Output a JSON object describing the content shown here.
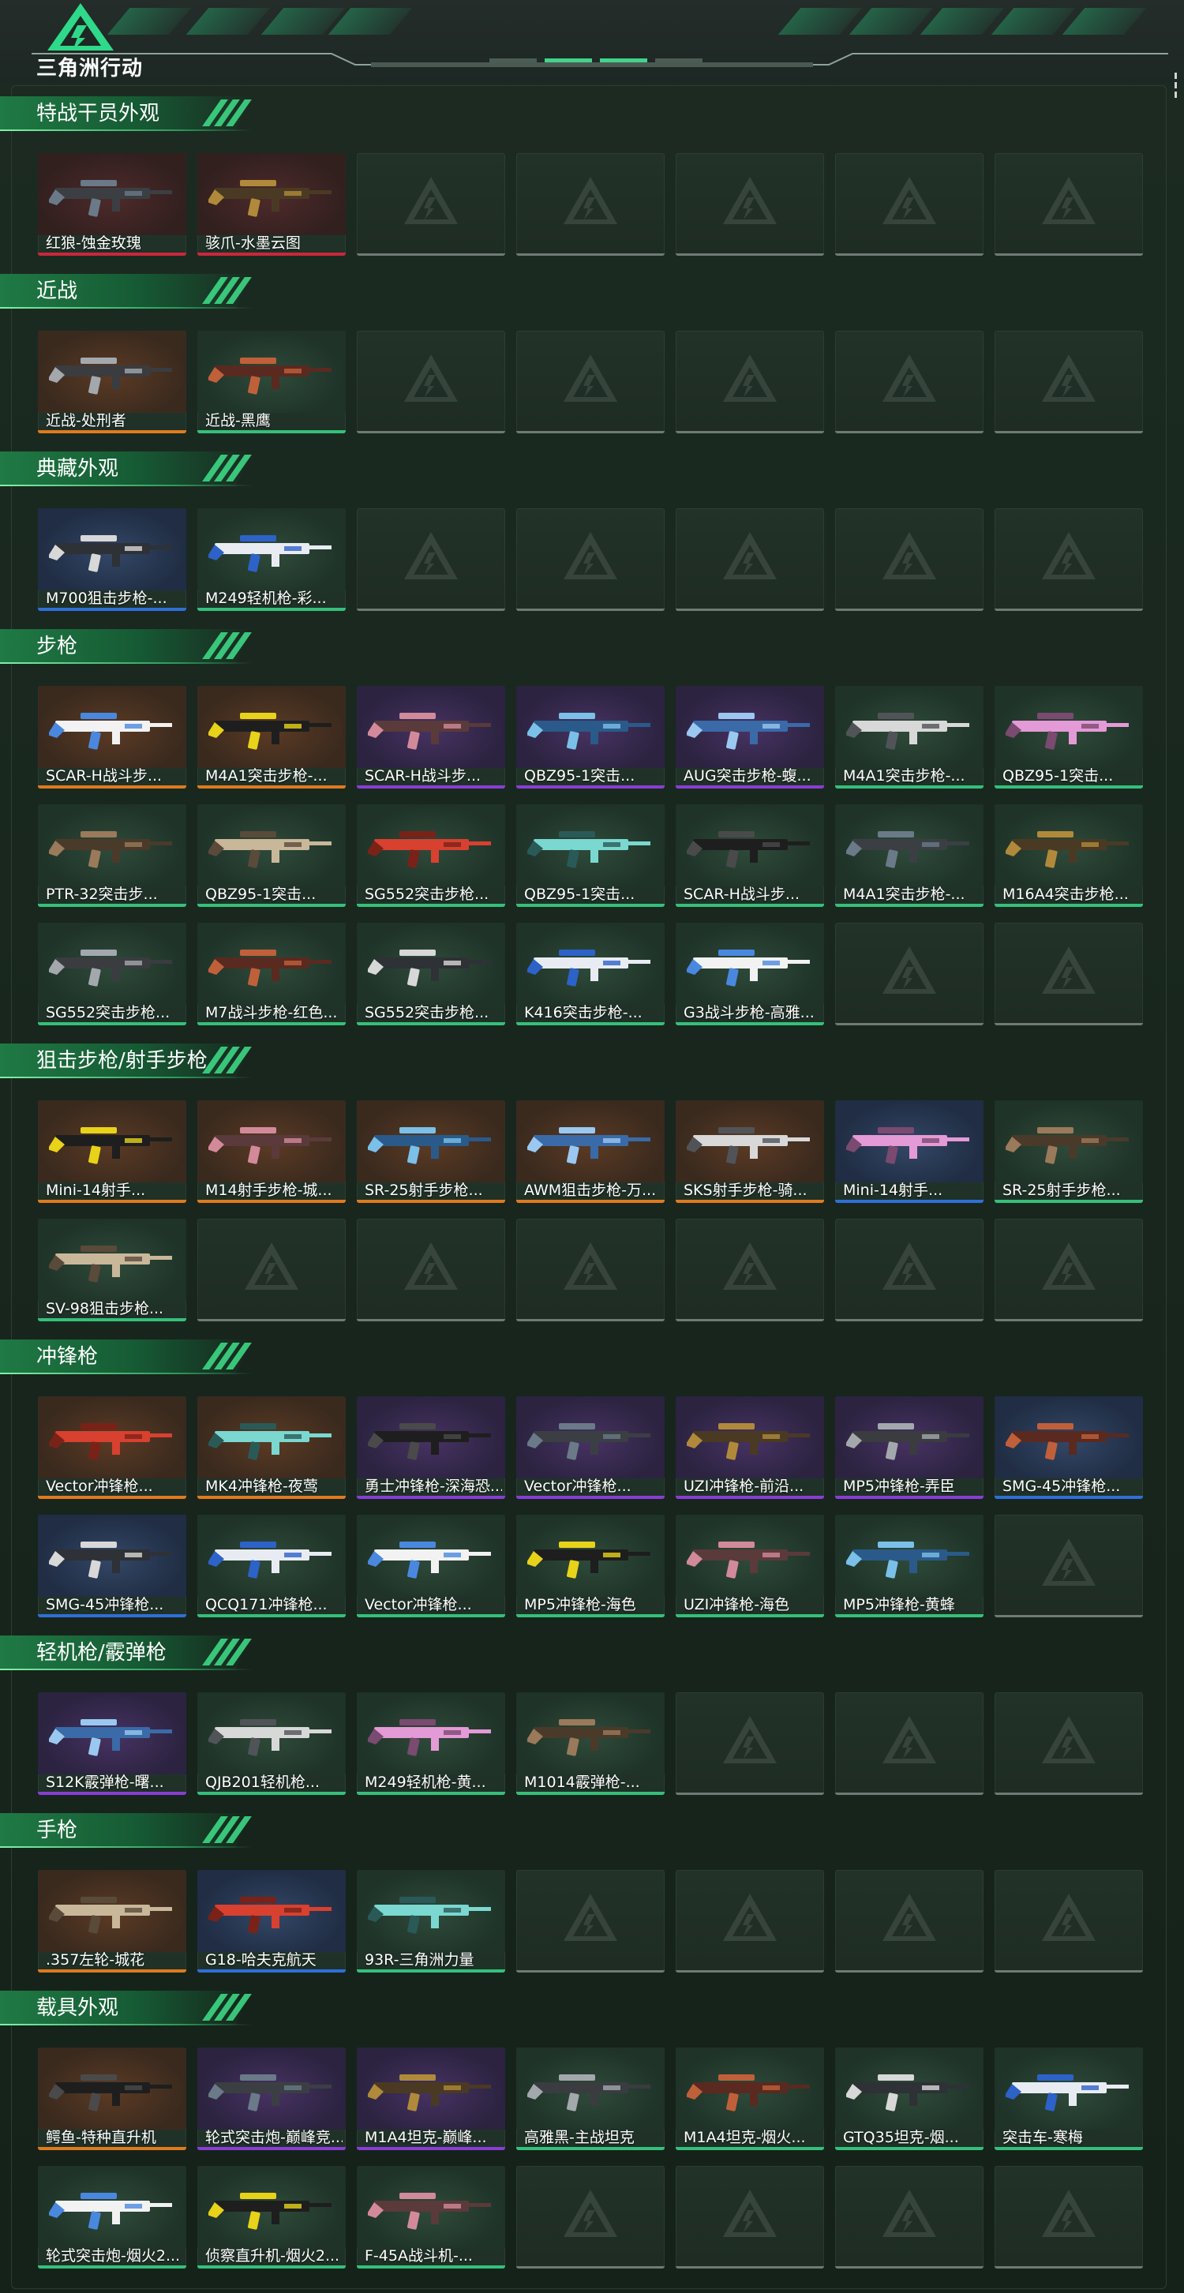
{
  "app": {
    "logo_text": "三角洲行动"
  },
  "colors": {
    "accent": "#35c07a",
    "rarity_orange": "#e07a1e",
    "rarity_red": "#c9283a",
    "rarity_purple": "#8a3dd6",
    "rarity_blue": "#2f6fd9",
    "rarity_green": "#35c07a",
    "empty_slot": "#6f7a75"
  },
  "sections": [
    {
      "title": "特战干员外观",
      "items": [
        {
          "label": "红狼-蚀金玫瑰",
          "rarity": "red"
        },
        {
          "label": "骇爪-水墨云图",
          "rarity": "red"
        }
      ]
    },
    {
      "title": "近战",
      "items": [
        {
          "label": "近战-处刑者",
          "rarity": "orange"
        },
        {
          "label": "近战-黑鹰",
          "rarity": "green"
        }
      ]
    },
    {
      "title": "典藏外观",
      "items": [
        {
          "label": "M700狙击步枪-...",
          "rarity": "blue"
        },
        {
          "label": "M249轻机枪-彩...",
          "rarity": "green"
        }
      ]
    },
    {
      "title": "步枪",
      "items": [
        {
          "label": "SCAR-H战斗步...",
          "rarity": "orange"
        },
        {
          "label": "M4A1突击步枪-...",
          "rarity": "orange"
        },
        {
          "label": "SCAR-H战斗步...",
          "rarity": "purple"
        },
        {
          "label": "QBZ95-1突击...",
          "rarity": "purple"
        },
        {
          "label": "AUG突击步枪-蝮...",
          "rarity": "purple"
        },
        {
          "label": "M4A1突击步枪-...",
          "rarity": "green"
        },
        {
          "label": "QBZ95-1突击...",
          "rarity": "green"
        },
        {
          "label": "PTR-32突击步...",
          "rarity": "green"
        },
        {
          "label": "QBZ95-1突击...",
          "rarity": "green"
        },
        {
          "label": "SG552突击步枪...",
          "rarity": "green"
        },
        {
          "label": "QBZ95-1突击...",
          "rarity": "green"
        },
        {
          "label": "SCAR-H战斗步...",
          "rarity": "green"
        },
        {
          "label": "M4A1突击步枪-...",
          "rarity": "green"
        },
        {
          "label": "M16A4突击步枪...",
          "rarity": "green"
        },
        {
          "label": "SG552突击步枪...",
          "rarity": "green"
        },
        {
          "label": "M7战斗步枪-红色...",
          "rarity": "green"
        },
        {
          "label": "SG552突击步枪...",
          "rarity": "green"
        },
        {
          "label": "K416突击步枪-...",
          "rarity": "green"
        },
        {
          "label": "G3战斗步枪-高雅...",
          "rarity": "green"
        }
      ]
    },
    {
      "title": "狙击步枪/射手步枪",
      "items": [
        {
          "label": "Mini-14射手...",
          "rarity": "orange"
        },
        {
          "label": "M14射手步枪-城...",
          "rarity": "orange"
        },
        {
          "label": "SR-25射手步枪...",
          "rarity": "orange"
        },
        {
          "label": "AWM狙击步枪-万...",
          "rarity": "orange"
        },
        {
          "label": "SKS射手步枪-骑...",
          "rarity": "orange"
        },
        {
          "label": "Mini-14射手...",
          "rarity": "blue"
        },
        {
          "label": "SR-25射手步枪...",
          "rarity": "green"
        },
        {
          "label": "SV-98狙击步枪...",
          "rarity": "green"
        }
      ]
    },
    {
      "title": "冲锋枪",
      "items": [
        {
          "label": "Vector冲锋枪...",
          "rarity": "orange"
        },
        {
          "label": "MK4冲锋枪-夜莺",
          "rarity": "orange"
        },
        {
          "label": "勇士冲锋枪-深海恐...",
          "rarity": "purple"
        },
        {
          "label": "Vector冲锋枪...",
          "rarity": "purple"
        },
        {
          "label": "UZI冲锋枪-前沿...",
          "rarity": "purple"
        },
        {
          "label": "MP5冲锋枪-弄臣",
          "rarity": "purple"
        },
        {
          "label": "SMG-45冲锋枪...",
          "rarity": "blue"
        },
        {
          "label": "SMG-45冲锋枪...",
          "rarity": "blue"
        },
        {
          "label": "QCQ171冲锋枪...",
          "rarity": "green"
        },
        {
          "label": "Vector冲锋枪...",
          "rarity": "green"
        },
        {
          "label": "MP5冲锋枪-海色",
          "rarity": "green"
        },
        {
          "label": "UZI冲锋枪-海色",
          "rarity": "green"
        },
        {
          "label": "MP5冲锋枪-黄蜂",
          "rarity": "green"
        }
      ]
    },
    {
      "title": "轻机枪/霰弹枪",
      "items": [
        {
          "label": "S12K霰弹枪-曙...",
          "rarity": "purple"
        },
        {
          "label": "QJB201轻机枪...",
          "rarity": "green"
        },
        {
          "label": "M249轻机枪-黄...",
          "rarity": "green"
        },
        {
          "label": "M1014霰弹枪-...",
          "rarity": "green"
        }
      ]
    },
    {
      "title": "手枪",
      "items": [
        {
          "label": ".357左轮-城花",
          "rarity": "orange"
        },
        {
          "label": "G18-哈夫克航天",
          "rarity": "blue"
        },
        {
          "label": "93R-三角洲力量",
          "rarity": "green"
        }
      ]
    },
    {
      "title": "载具外观",
      "items": [
        {
          "label": "鳄鱼-特种直升机",
          "rarity": "orange"
        },
        {
          "label": "轮式突击炮-巅峰竞...",
          "rarity": "purple"
        },
        {
          "label": "M1A4坦克-巅峰...",
          "rarity": "purple"
        },
        {
          "label": "高雅黑-主战坦克",
          "rarity": "green"
        },
        {
          "label": "M1A4坦克-烟火...",
          "rarity": "green"
        },
        {
          "label": "GTQ35坦克-烟...",
          "rarity": "green"
        },
        {
          "label": "突击车-寒梅",
          "rarity": "green"
        },
        {
          "label": "轮式突击炮-烟火2...",
          "rarity": "green"
        },
        {
          "label": "侦察直升机-烟火2...",
          "rarity": "green"
        },
        {
          "label": "F-45A战斗机-...",
          "rarity": "green"
        }
      ]
    }
  ]
}
